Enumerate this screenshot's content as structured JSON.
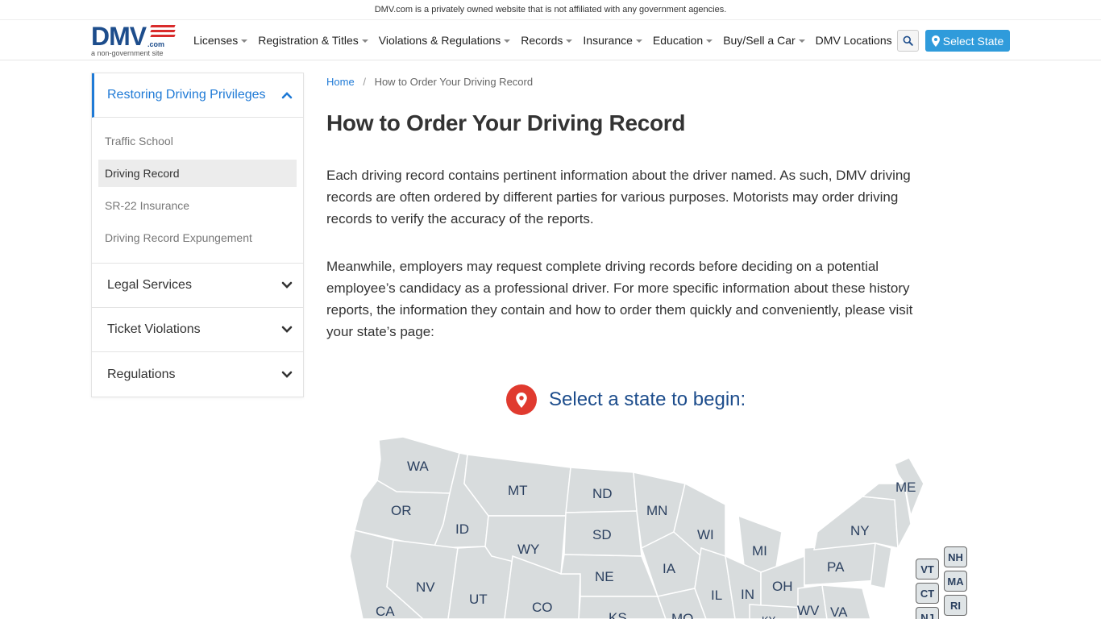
{
  "topbar": {
    "disclaimer": "DMV.com is a privately owned website that is not affiliated with any government agencies."
  },
  "logo": {
    "text": "DMV",
    "com": ".com",
    "sub": "a non-government site"
  },
  "nav": [
    {
      "label": "Licenses",
      "dropdown": true
    },
    {
      "label": "Registration & Titles",
      "dropdown": true
    },
    {
      "label": "Violations & Regulations",
      "dropdown": true
    },
    {
      "label": "Records",
      "dropdown": true
    },
    {
      "label": "Insurance",
      "dropdown": true
    },
    {
      "label": "Education",
      "dropdown": true
    },
    {
      "label": "Buy/Sell a Car",
      "dropdown": true
    },
    {
      "label": "DMV Locations",
      "dropdown": false
    }
  ],
  "header": {
    "select_state": "Select State",
    "search_icon": "search-icon"
  },
  "sidebar": {
    "open_section": "Restoring Driving Privileges",
    "sub_items": [
      "Traffic School",
      "Driving Record",
      "SR-22 Insurance",
      "Driving Record Expungement"
    ],
    "active_index": 1,
    "sections": [
      "Legal Services",
      "Ticket Violations",
      "Regulations"
    ]
  },
  "breadcrumb": {
    "home": "Home",
    "separator": "/",
    "current": "How to Order Your Driving Record"
  },
  "page": {
    "title": "How to Order Your Driving Record",
    "p1": "Each driving record contains pertinent information about the driver named. As such, DMV driving records are often ordered by different parties for various purposes. Motorists may order driving records to verify the accuracy of the reports.",
    "p2": "Meanwhile, employers may request complete driving records before deciding on a potential employee’s candidacy as a professional driver. For more specific information about these history reports, the information they contain and how to order them quickly and conveniently, please visit your state’s page:"
  },
  "map": {
    "heading": "Select a state to begin:",
    "states": [
      "WA",
      "OR",
      "ID",
      "MT",
      "ND",
      "MN",
      "ME",
      "SD",
      "WI",
      "NY",
      "WY",
      "MI",
      "NV",
      "NE",
      "IA",
      "PA",
      "UT",
      "IL",
      "IN",
      "OH",
      "CA",
      "CO",
      "KS",
      "MO",
      "WV",
      "VA",
      "KY"
    ],
    "small_states": [
      "NH",
      "VT",
      "MA",
      "CT",
      "RI",
      "NJ"
    ]
  },
  "colors": {
    "accent": "#1f7ad6",
    "brand": "#1d4d8c",
    "button": "#2f9bdb",
    "pin": "#e03a2f",
    "map_fill": "#d8dcdd"
  }
}
